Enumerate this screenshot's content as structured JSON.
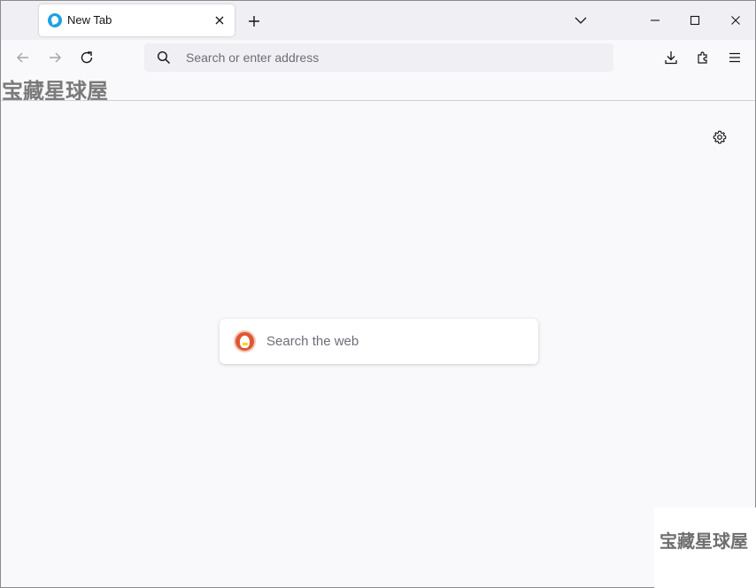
{
  "tabs": [
    {
      "title": "New Tab",
      "favicon": "firefox-icon",
      "active": true
    }
  ],
  "toolbar": {
    "url_placeholder": "Search or enter address",
    "icons": [
      "back-icon",
      "forward-icon",
      "reload-icon",
      "search-icon",
      "download-icon",
      "extensions-icon",
      "menu-icon"
    ]
  },
  "watermark": {
    "top_text": "宝藏星球屋",
    "bottom_text": "宝藏星球屋"
  },
  "newtab": {
    "search_placeholder": "Search the web",
    "search_engine_icon": "duckduckgo-icon",
    "settings_icon": "gear-icon"
  },
  "colors": {
    "page_background": "#f9f9fb",
    "tabstrip_background": "#f0f0f4",
    "urlbar_background": "#f0f0f4",
    "accent": "#1fa1e4"
  }
}
